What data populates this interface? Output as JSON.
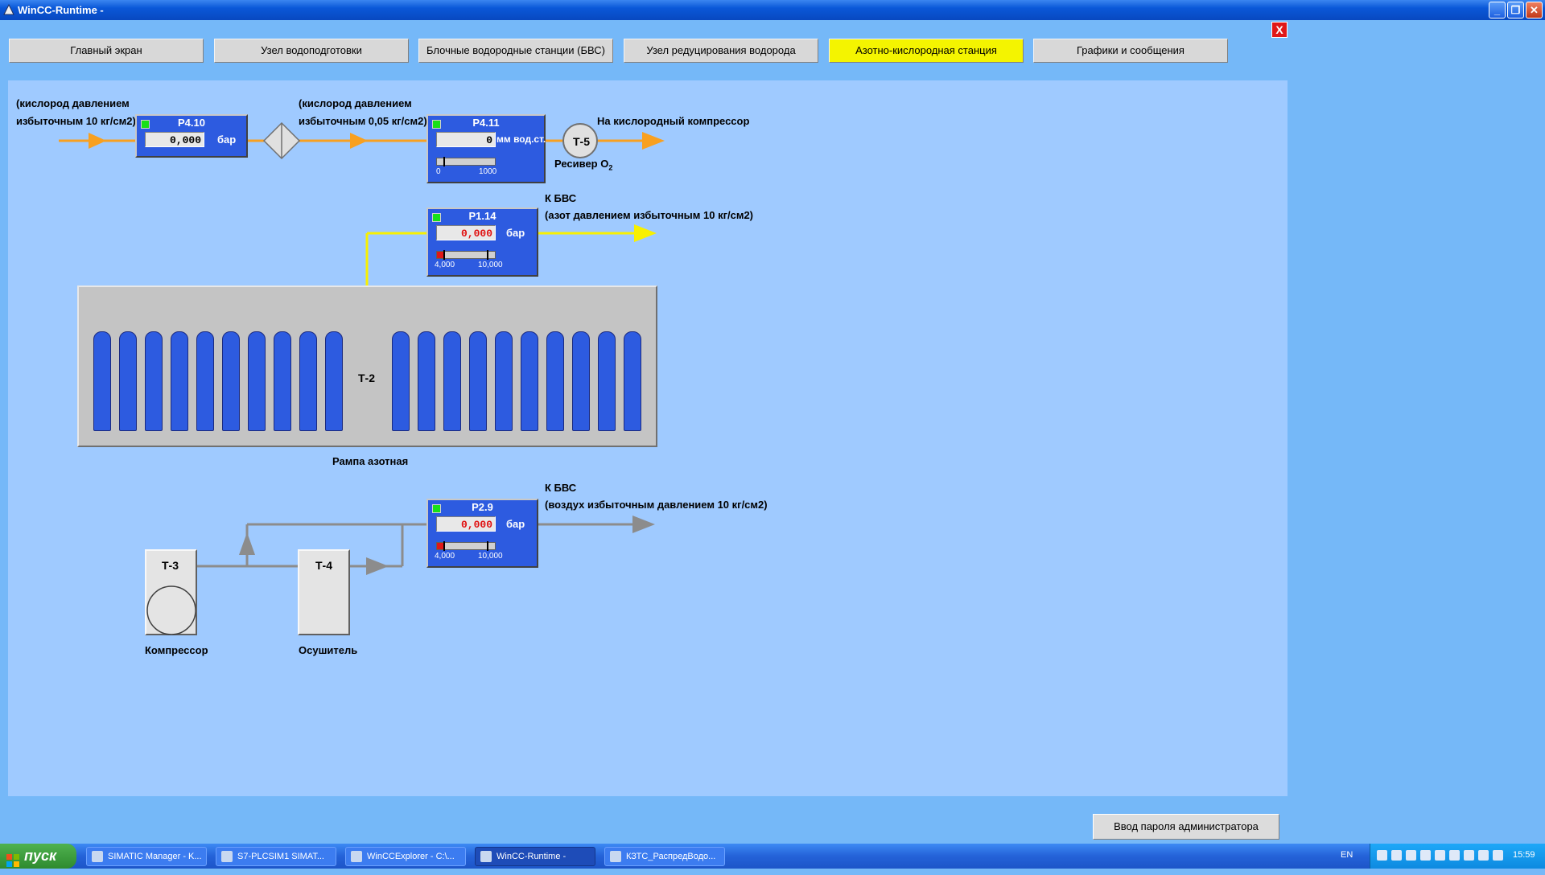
{
  "window": {
    "title": "WinCC-Runtime -"
  },
  "nav": [
    {
      "label": "Главный экран"
    },
    {
      "label": "Узел водоподготовки"
    },
    {
      "label": "Блочные водородные станции (БВС)"
    },
    {
      "label": "Узел редуцирования водорода"
    },
    {
      "label": "Азотно-кислородная станция"
    },
    {
      "label": "Графики и сообщения"
    }
  ],
  "close_x": "X",
  "labels": {
    "o2_in_1": "(кислород давлением",
    "o2_in_2": "избыточным 10 кг/см2)",
    "o2_mid_1": "(кислород давлением",
    "o2_mid_2": "избыточным 0,05 кг/см2)",
    "o2_out": "На кислородный компрессор",
    "receiver_tag": "Т-5",
    "receiver_name": "Ресивер O",
    "receiver_sub": "2",
    "n2_to_1": "К БВС",
    "n2_to_2": "(азот давлением избыточным 10 кг/см2)",
    "ramp_tag": "Т-2",
    "ramp_name": "Рампа азотная",
    "air_to_1": "К БВС",
    "air_to_2": "(воздух избыточным давлением 10 кг/см2)",
    "comp_tag": "Т-3",
    "comp_name": "Компрессор",
    "dryer_tag": "Т-4",
    "dryer_name": "Осушитель"
  },
  "instruments": {
    "p410": {
      "tag": "P4.10",
      "value": "0,000",
      "unit": "бар"
    },
    "p411": {
      "tag": "P4.11",
      "value": "0",
      "unit": "мм вод.ст.",
      "scale_min": "0",
      "scale_max": "1000"
    },
    "p114": {
      "tag": "P1.14",
      "value": "0,000",
      "unit": "бар",
      "scale_min": "4,000",
      "scale_max": "10,000"
    },
    "p29": {
      "tag": "P2.9",
      "value": "0,000",
      "unit": "бар",
      "scale_min": "4,000",
      "scale_max": "10,000"
    }
  },
  "admin_button": "Ввод пароля администратора",
  "taskbar": {
    "start": "пуск",
    "tasks": [
      {
        "label": "SIMATIC Manager - K..."
      },
      {
        "label": "S7-PLCSIM1    SIMAT..."
      },
      {
        "label": "WinCCExplorer - C:\\..."
      },
      {
        "label": "WinCC-Runtime -"
      },
      {
        "label": "КЗТС_РаспредВодо..."
      }
    ],
    "lang": "EN",
    "clock": "15:59"
  },
  "colors": {
    "oxygen": "#f8a020",
    "nitrogen": "#f8f000",
    "air": "#8c8c8c",
    "instrument": "#2d5be0",
    "active_tab": "#f4f400"
  }
}
